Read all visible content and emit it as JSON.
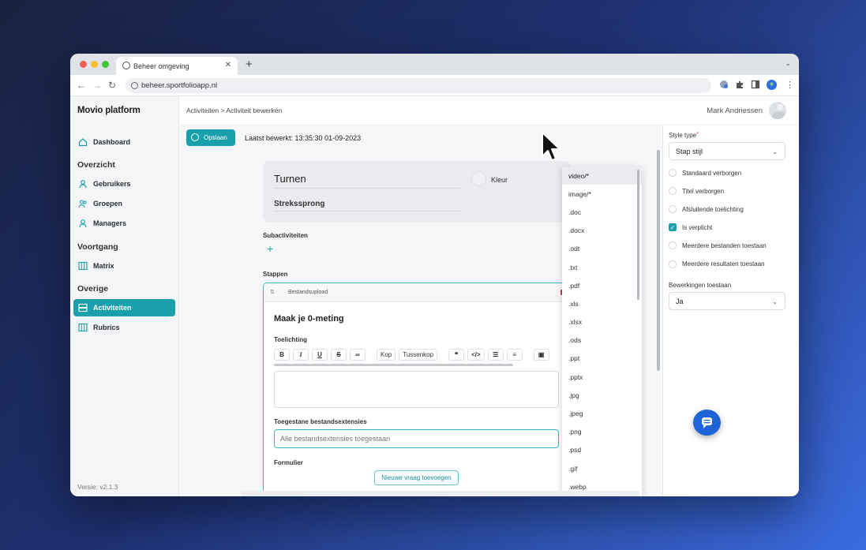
{
  "browser": {
    "tab_title": "Beheer omgeving",
    "url": "beheer.sportfolioapp.nl",
    "traffic_colors": [
      "#ee5e56",
      "#f5bd30",
      "#45c33a"
    ]
  },
  "sidebar": {
    "brand": "Movio platform",
    "items": [
      {
        "label": "Dashboard",
        "icon": "home-icon"
      },
      {
        "section": "Overzicht"
      },
      {
        "label": "Gebruikers",
        "icon": "user-icon"
      },
      {
        "label": "Groepen",
        "icon": "users-icon"
      },
      {
        "label": "Managers",
        "icon": "user-icon"
      },
      {
        "section": "Voortgang"
      },
      {
        "label": "Matrix",
        "icon": "grid-icon"
      },
      {
        "section": "Overige"
      },
      {
        "label": "Activiteiten",
        "icon": "list-icon",
        "active": true
      },
      {
        "label": "Rubrics",
        "icon": "grid-icon"
      }
    ],
    "version": "Versie: v2.1.3"
  },
  "header": {
    "breadcrumb": [
      "Activiteiten",
      ">",
      "Activiteit bewerken"
    ],
    "user_name": "Mark Andriessen"
  },
  "toolbar": {
    "save_label": "Opslaan",
    "last_edited": "Laatst bewerkt: 13:35:30 01-09-2023"
  },
  "activity": {
    "title": "Turnen",
    "subtitle": "Strekssprong",
    "color_label": "Kleur",
    "subactivities_label": "Subactiviteiten",
    "steps_label": "Stappen"
  },
  "step": {
    "type": "Bestandsupload",
    "title": "Maak je 0-meting",
    "description_label": "Toelichting",
    "rte_buttons": [
      "B",
      "I",
      "U",
      "S",
      "link",
      "Kop",
      "Tussenkop",
      "quote",
      "code",
      "ul",
      "ol",
      "img"
    ],
    "extensions_label": "Toegestane bestandsextensies",
    "extensions_placeholder": "Alle bestandsextensies toegestaan",
    "form_label": "Formulier",
    "new_question_label": "Nieuwe vraag toevoegen"
  },
  "dropdown_options": [
    "video/*",
    "image/*",
    ".doc",
    ".docx",
    ".odt",
    ".txt",
    ".pdf",
    ".xls",
    ".xlsx",
    ".ods",
    ".ppt",
    ".pptx",
    ".jpg",
    ".jpeg",
    ".png",
    ".psd",
    ".gif",
    ".webp"
  ],
  "dropdown_highlighted": 0,
  "right_panel": {
    "style_type_label": "Style type",
    "style_type_value": "Stap stijl",
    "options": [
      {
        "label": "Standaard verborgen",
        "checked": false
      },
      {
        "label": "Titel verborgen",
        "checked": false
      },
      {
        "label": "Afsluitende toelichting",
        "checked": false
      },
      {
        "label": "Is verplicht",
        "checked": true
      },
      {
        "label": "Meerdere bestanden toestaan",
        "checked": false
      },
      {
        "label": "Meerdere resultaten toestaan",
        "checked": false
      }
    ],
    "edits_label": "Bewerkingen toestaan",
    "edits_value": "Ja"
  },
  "colors": {
    "accent": "#1aa0ad",
    "chat": "#1d64d8"
  }
}
